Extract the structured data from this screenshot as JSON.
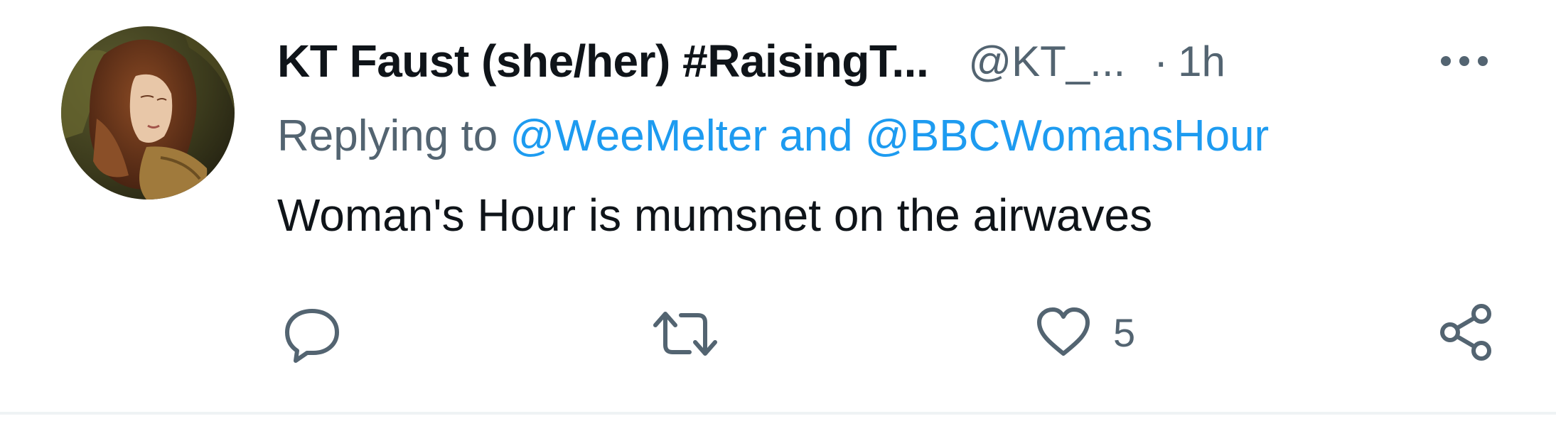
{
  "tweet": {
    "display_name": "KT Faust (she/her) #RaisingT...",
    "handle": "@KT_...",
    "separator": "·",
    "time": "1h",
    "replying_prefix": "Replying to",
    "reply_mention_1": "@WeeMelter",
    "reply_conjunction": "and",
    "reply_mention_2": "@BBCWomansHour",
    "text": "Woman's Hour is mumsnet on the airwaves"
  },
  "actions": {
    "reply_icon": "reply-icon",
    "retweet_icon": "retweet-icon",
    "like_icon": "heart-icon",
    "like_count": "5",
    "share_icon": "share-icon"
  },
  "colors": {
    "text_primary": "#0f1419",
    "text_secondary": "#536471",
    "link": "#1d9bf0",
    "divider": "#eff3f4"
  }
}
